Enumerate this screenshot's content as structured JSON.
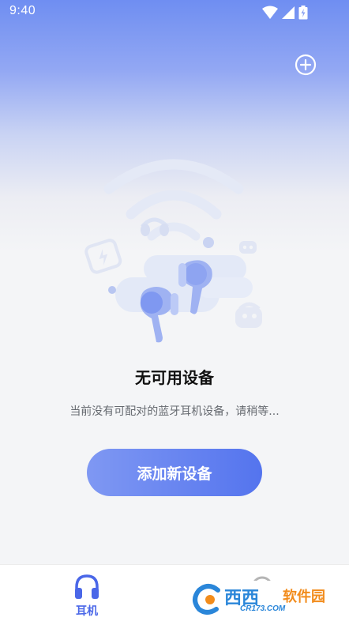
{
  "status_bar": {
    "time": "9:40",
    "icons": [
      "wifi-icon",
      "signal-icon",
      "battery-charging-icon"
    ]
  },
  "header": {
    "add_icon": "plus-circle-icon"
  },
  "empty_state": {
    "title": "无可用设备",
    "description": "当前没有可配对的蓝牙耳机设备，请稍等...",
    "button_label": "添加新设备"
  },
  "bottom_nav": {
    "items": [
      {
        "label": "耳机",
        "icon": "headphones-icon",
        "active": true
      },
      {
        "label": "",
        "icon": "settings-icon",
        "active": false
      }
    ]
  },
  "watermark": {
    "text": "西西",
    "text2": "软件园",
    "sub": "CR173.COM"
  },
  "colors": {
    "accent": "#4a67e8",
    "button_start": "#7f98f3",
    "button_end": "#5474ee",
    "header_top": "#6f8ef2"
  }
}
